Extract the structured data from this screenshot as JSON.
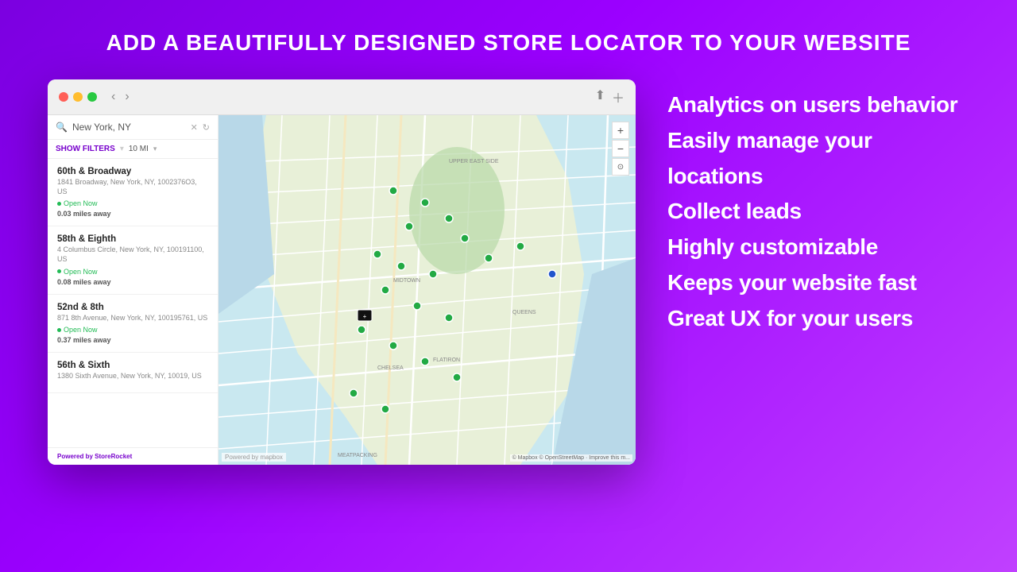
{
  "page": {
    "title": "ADD A BEAUTIFULLY DESIGNED STORE LOCATOR TO YOUR WEBSITE",
    "background_gradient_start": "#7b00e0",
    "background_gradient_end": "#c040ff"
  },
  "browser": {
    "traffic_lights": [
      "red",
      "yellow",
      "green"
    ],
    "nav_back": "‹",
    "nav_forward": "›",
    "search_value": "New York, NY",
    "filter_label": "SHOW FILTERS",
    "filter_distance": "10 MI"
  },
  "locations": [
    {
      "name": "60th & Broadway",
      "address": "1841 Broadway, New York, NY, 1002376O3, US",
      "open": true,
      "open_label": "Open Now",
      "distance": "0.03 miles away"
    },
    {
      "name": "58th & Eighth",
      "address": "4 Columbus Circle, New York, NY, 100191100, US",
      "open": true,
      "open_label": "Open Now",
      "distance": "0.08 miles away"
    },
    {
      "name": "52nd & 8th",
      "address": "871 8th Avenue, New York, NY, 100195761, US",
      "open": true,
      "open_label": "Open Now",
      "distance": "0.37 miles away"
    },
    {
      "name": "56th & Sixth",
      "address": "1380 Sixth Avenue, New York, NY, 10019, US",
      "open": false,
      "open_label": "",
      "distance": ""
    }
  ],
  "powered_by": {
    "prefix": "Powered by ",
    "brand": "StoreRocket"
  },
  "features": [
    "Analytics on users behavior",
    "Easily manage your locations",
    "Collect leads",
    "Highly customizable",
    "Keeps your website fast",
    "Great UX for your users"
  ],
  "map": {
    "attribution": "© Mapbox © OpenStreetMap · Improve this m...",
    "logo": "Powered by mapbox"
  }
}
